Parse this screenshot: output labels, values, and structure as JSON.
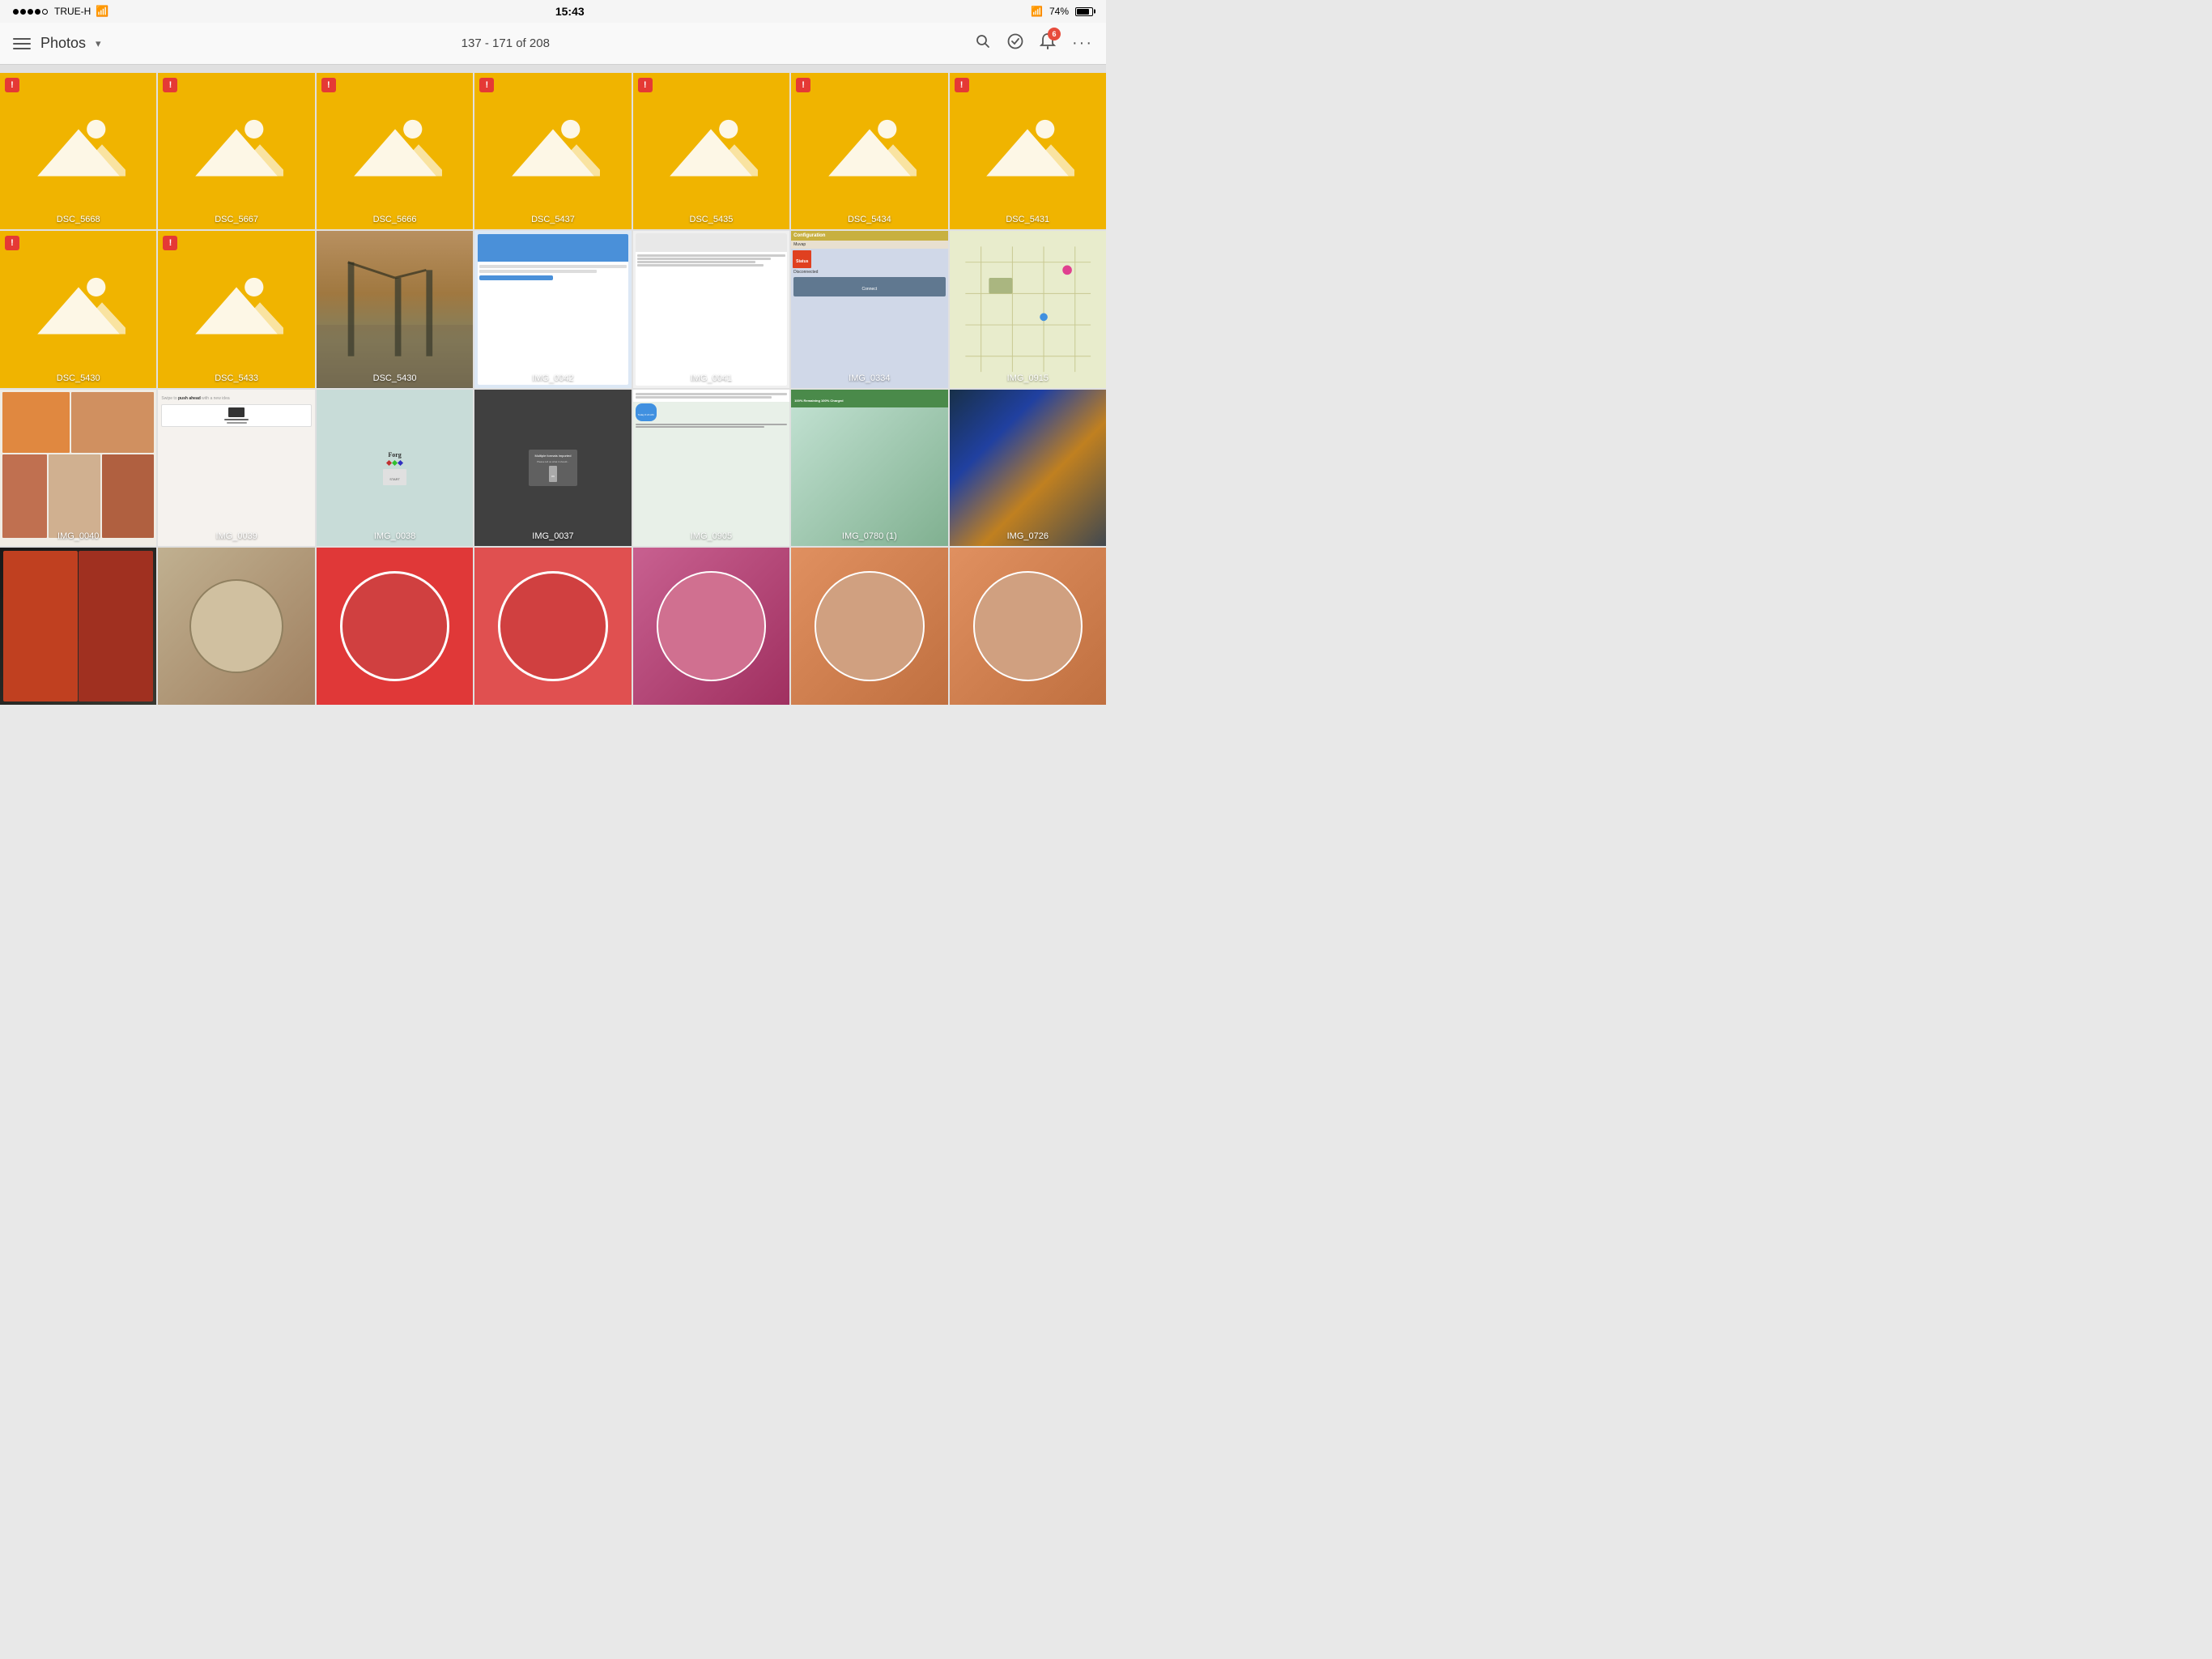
{
  "statusBar": {
    "carrier": "TRUE-H",
    "time": "15:43",
    "batteryPercent": "74%",
    "wifi": true
  },
  "navBar": {
    "title": "Photos",
    "count": "137 - 171 of 208",
    "notificationCount": "6"
  },
  "grid": {
    "rows": [
      [
        {
          "id": "DSC_5668",
          "type": "placeholder",
          "label": "DSC_5668",
          "warning": true
        },
        {
          "id": "DSC_5667",
          "type": "placeholder",
          "label": "DSC_5667",
          "warning": true
        },
        {
          "id": "DSC_5666",
          "type": "placeholder",
          "label": "DSC_5666",
          "warning": true
        },
        {
          "id": "DSC_5437",
          "type": "placeholder",
          "label": "DSC_5437",
          "warning": true
        },
        {
          "id": "DSC_5435",
          "type": "placeholder",
          "label": "DSC_5435",
          "warning": true
        },
        {
          "id": "DSC_5434",
          "type": "placeholder",
          "label": "DSC_5434",
          "warning": true
        },
        {
          "id": "DSC_5431",
          "type": "placeholder",
          "label": "DSC_5431",
          "warning": true
        }
      ],
      [
        {
          "id": "DSC_5430a",
          "type": "placeholder",
          "label": "DSC_5430",
          "warning": true
        },
        {
          "id": "DSC_5433",
          "type": "placeholder",
          "label": "DSC_5433",
          "warning": true
        },
        {
          "id": "DSC_5430b",
          "type": "real",
          "label": "DSC_5430",
          "warning": false,
          "bg": "#c8a060"
        },
        {
          "id": "IMG_0042",
          "type": "screenshot",
          "label": "IMG_0042",
          "warning": false,
          "bg": "#dce8f5"
        },
        {
          "id": "IMG_0041",
          "type": "screenshot",
          "label": "IMG_0041",
          "warning": false,
          "bg": "#f0f0f0"
        },
        {
          "id": "IMG_0334",
          "type": "screenshot",
          "label": "IMG_0334",
          "warning": false,
          "bg": "#d0d8e8"
        },
        {
          "id": "IMG_0915",
          "type": "screenshot",
          "label": "IMG_0915",
          "warning": false,
          "bg": "#e8eccc"
        }
      ],
      [
        {
          "id": "IMG_0040",
          "type": "screenshot",
          "label": "IMG_0040",
          "warning": false,
          "bg": "#e8dcc8"
        },
        {
          "id": "IMG_0039",
          "type": "screenshot",
          "label": "IMG_0039",
          "warning": false,
          "bg": "#f0ede8"
        },
        {
          "id": "IMG_0038",
          "type": "screenshot",
          "label": "IMG_0038",
          "warning": false,
          "bg": "#dce8e4"
        },
        {
          "id": "IMG_0037",
          "type": "screenshot",
          "label": "IMG_0037",
          "warning": false,
          "bg": "#404040"
        },
        {
          "id": "IMG_0905",
          "type": "screenshot",
          "label": "IMG_0905",
          "warning": false,
          "bg": "#dce4ec"
        },
        {
          "id": "IMG_0780",
          "type": "screenshot",
          "label": "IMG_0780 (1)",
          "warning": false,
          "bg": "#e8f0e8"
        },
        {
          "id": "IMG_0726",
          "type": "screenshot",
          "label": "IMG_0726",
          "warning": false,
          "bg": "#183048"
        }
      ],
      [
        {
          "id": "row4_1",
          "type": "screenshot",
          "label": "",
          "warning": false,
          "bg": "#181818"
        },
        {
          "id": "row4_2",
          "type": "screenshot",
          "label": "",
          "warning": false,
          "bg": "#c0b090"
        },
        {
          "id": "row4_3",
          "type": "screenshot",
          "label": "",
          "warning": false,
          "bg": "#e03838"
        },
        {
          "id": "row4_4",
          "type": "screenshot",
          "label": "",
          "warning": false,
          "bg": "#e05050"
        },
        {
          "id": "row4_5",
          "type": "screenshot",
          "label": "",
          "warning": false,
          "bg": "#c86090"
        },
        {
          "id": "row4_6",
          "type": "screenshot",
          "label": "",
          "warning": false,
          "bg": "#e08060"
        },
        {
          "id": "row4_7",
          "type": "screenshot",
          "label": "",
          "warning": false,
          "bg": "#c89060"
        }
      ]
    ]
  },
  "icons": {
    "search": "🔍",
    "checkCircle": "✓",
    "bell": "🔔",
    "more": "•••"
  }
}
